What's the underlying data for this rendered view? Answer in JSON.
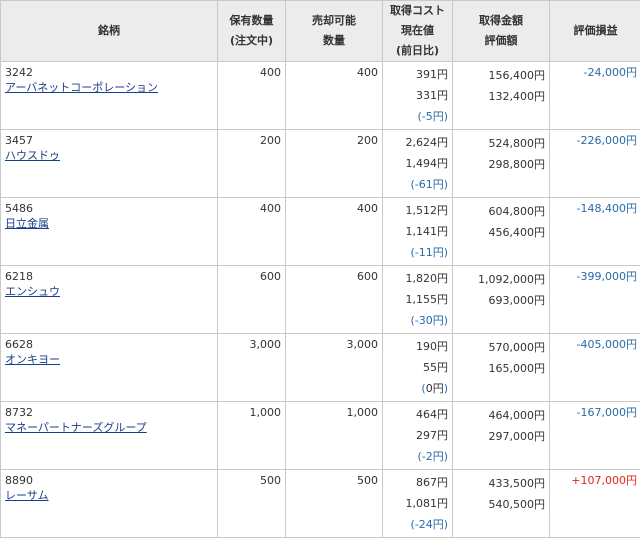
{
  "headers": {
    "name": "銘柄",
    "hold_qty": [
      "保有数量",
      "(注文中)"
    ],
    "sell_qty": [
      "売却可能",
      "数量"
    ],
    "cost": [
      "取得コスト",
      "現在値",
      "(前日比)"
    ],
    "amount": [
      "取得金額",
      "評価額"
    ],
    "pl": "評価損益"
  },
  "rows": [
    {
      "code": "3242",
      "name": "アーバネットコーポレーション",
      "hold": "400",
      "sell": "400",
      "cost": "391円",
      "price": "331円",
      "change": "-5円",
      "change_sign": "neg",
      "acquired": "156,400円",
      "valuation": "132,400円",
      "pl": "-24,000円",
      "pl_sign": "neg"
    },
    {
      "code": "3457",
      "name": "ハウスドゥ",
      "hold": "200",
      "sell": "200",
      "cost": "2,624円",
      "price": "1,494円",
      "change": "-61円",
      "change_sign": "neg",
      "acquired": "524,800円",
      "valuation": "298,800円",
      "pl": "-226,000円",
      "pl_sign": "neg"
    },
    {
      "code": "5486",
      "name": "日立金属",
      "hold": "400",
      "sell": "400",
      "cost": "1,512円",
      "price": "1,141円",
      "change": "-11円",
      "change_sign": "neg",
      "acquired": "604,800円",
      "valuation": "456,400円",
      "pl": "-148,400円",
      "pl_sign": "neg"
    },
    {
      "code": "6218",
      "name": "エンシュウ",
      "hold": "600",
      "sell": "600",
      "cost": "1,820円",
      "price": "1,155円",
      "change": "-30円",
      "change_sign": "neg",
      "acquired": "1,092,000円",
      "valuation": "693,000円",
      "pl": "-399,000円",
      "pl_sign": "neg"
    },
    {
      "code": "6628",
      "name": "オンキヨー",
      "hold": "3,000",
      "sell": "3,000",
      "cost": "190円",
      "price": "55円",
      "change": "0円",
      "change_sign": "zero",
      "acquired": "570,000円",
      "valuation": "165,000円",
      "pl": "-405,000円",
      "pl_sign": "neg"
    },
    {
      "code": "8732",
      "name": "マネーパートナーズグループ",
      "hold": "1,000",
      "sell": "1,000",
      "cost": "464円",
      "price": "297円",
      "change": "-2円",
      "change_sign": "neg",
      "acquired": "464,000円",
      "valuation": "297,000円",
      "pl": "-167,000円",
      "pl_sign": "neg"
    },
    {
      "code": "8890",
      "name": "レーサム",
      "hold": "500",
      "sell": "500",
      "cost": "867円",
      "price": "1,081円",
      "change": "-24円",
      "change_sign": "neg",
      "acquired": "433,500円",
      "valuation": "540,500円",
      "pl": "+107,000円",
      "pl_sign": "pos"
    }
  ],
  "colors": {
    "negative": "#2a6aa8",
    "positive": "#e8231b",
    "link": "#1a3e8c",
    "header_bg": "#ececec",
    "border": "#c9c9c9"
  }
}
